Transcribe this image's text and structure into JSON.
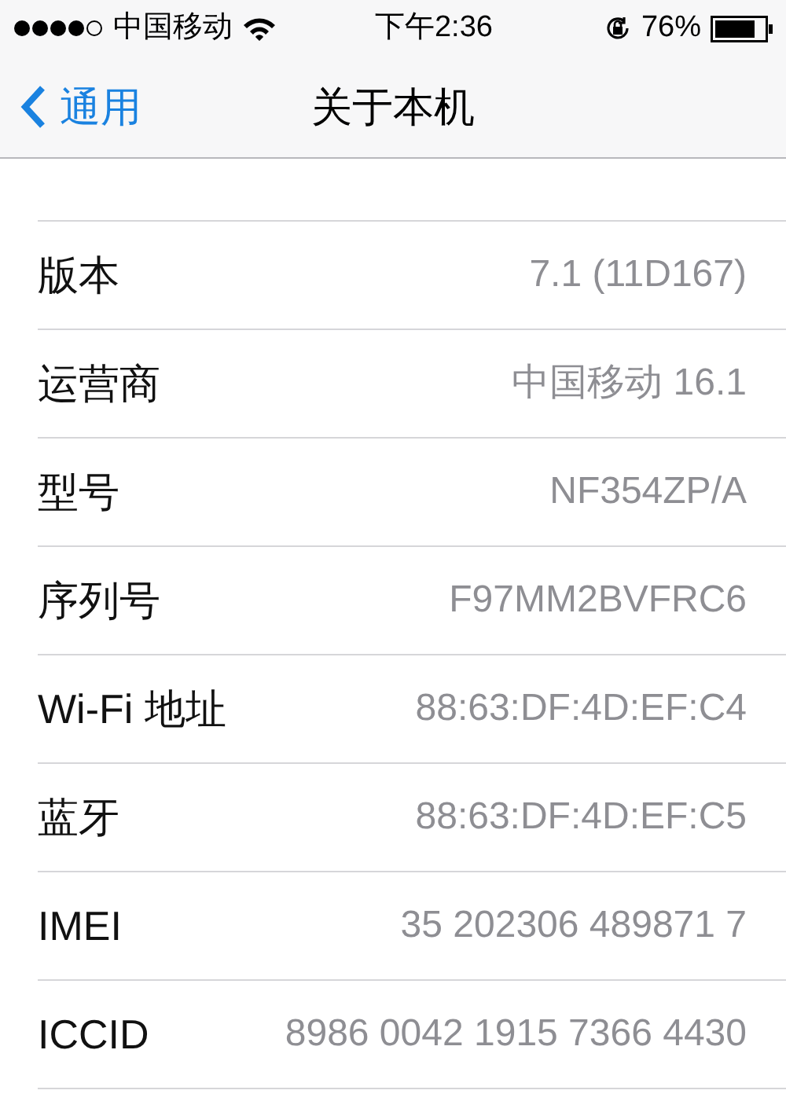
{
  "status_bar": {
    "carrier": "中国移动",
    "time": "下午2:36",
    "battery": "76%"
  },
  "nav": {
    "back": "通用",
    "title": "关于本机"
  },
  "rows": [
    {
      "label": "版本",
      "value": "7.1 (11D167)"
    },
    {
      "label": "运营商",
      "value": "中国移动 16.1"
    },
    {
      "label": "型号",
      "value": "NF354ZP/A"
    },
    {
      "label": "序列号",
      "value": "F97MM2BVFRC6"
    },
    {
      "label": "Wi-Fi 地址",
      "value": "88:63:DF:4D:EF:C4"
    },
    {
      "label": "蓝牙",
      "value": "88:63:DF:4D:EF:C5"
    },
    {
      "label": "IMEI",
      "value": "35 202306 489871 7"
    },
    {
      "label": "ICCID",
      "value": "8986 0042 1915 7366 4430"
    }
  ]
}
